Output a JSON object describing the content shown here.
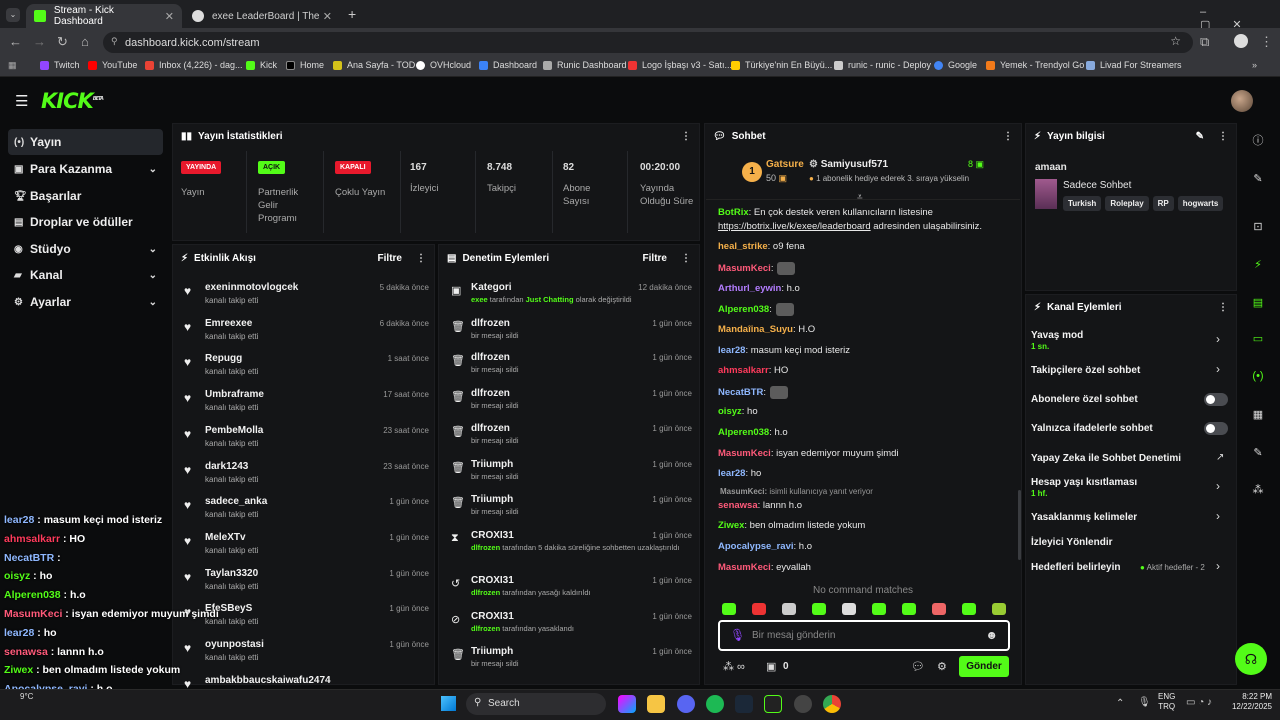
{
  "browser": {
    "tabs": [
      {
        "label": "Stream - Kick Dashboard"
      },
      {
        "label": "exee LeaderBoard | The best Ch"
      }
    ],
    "url": "dashboard.kick.com/stream",
    "bookmarks": [
      "Twitch",
      "YouTube",
      "Inbox (4,226) - dag...",
      "Kick",
      "Home",
      "Ana Sayfa - TOD",
      "OVHcloud",
      "Dashboard",
      "Runic Dashboard",
      "Logo İşbaşı v3 - Satı...",
      "Türkiye'nin En Büyü...",
      "runic - runic - Deploy",
      "Google",
      "Yemek - Trendyol Go",
      "Livad For Streamers"
    ]
  },
  "kick": {
    "logo": "KICK",
    "logo_beta": "BETA"
  },
  "sidebar": [
    {
      "label": "Yayın"
    },
    {
      "label": "Para Kazanma"
    },
    {
      "label": "Başarılar"
    },
    {
      "label": "Droplar ve ödüller"
    },
    {
      "label": "Stüdyo"
    },
    {
      "label": "Kanal"
    },
    {
      "label": "Ayarlar"
    }
  ],
  "stats": {
    "title": "Yayın İstatistikleri",
    "live_badge": "YAYINDA",
    "live_label": "Yayın",
    "partner_badge": "AÇIK",
    "partner_label": "Partnerlik Gelir Programı",
    "multi_badge": "KAPALI",
    "multi_label": "Çoklu Yayın",
    "viewers": "167",
    "viewers_label": "İzleyici",
    "followers": "8.748",
    "followers_label": "Takipçi",
    "subs": "82",
    "subs_label": "Abone Sayısı",
    "uptime": "00:20:00",
    "uptime_label": "Yayında Olduğu Süre"
  },
  "activity": {
    "title": "Etkinlik Akışı",
    "filter": "Filtre",
    "items": [
      {
        "name": "exeninmotovlogcek",
        "action": "kanalı takip etti",
        "time": "5 dakika önce"
      },
      {
        "name": "Emreexee",
        "action": "kanalı takip etti",
        "time": "6 dakika önce"
      },
      {
        "name": "Repugg",
        "action": "kanalı takip etti",
        "time": "1 saat önce"
      },
      {
        "name": "Umbraframe",
        "action": "kanalı takip etti",
        "time": "17 saat önce"
      },
      {
        "name": "PembeMolla",
        "action": "kanalı takip etti",
        "time": "23 saat önce"
      },
      {
        "name": "dark1243",
        "action": "kanalı takip etti",
        "time": "23 saat önce"
      },
      {
        "name": "sadece_anka",
        "action": "kanalı takip etti",
        "time": "1 gün önce"
      },
      {
        "name": "MeleXTv",
        "action": "kanalı takip etti",
        "time": "1 gün önce"
      },
      {
        "name": "Taylan3320",
        "action": "kanalı takip etti",
        "time": "1 gün önce"
      },
      {
        "name": "EfeSBeyS",
        "action": "kanalı takip etti",
        "time": "1 gün önce"
      },
      {
        "name": "oyunpostasi",
        "action": "kanalı takip etti",
        "time": "1 gün önce"
      },
      {
        "name": "ambakbbaucskaiwafu2474",
        "action": "",
        "time": ""
      }
    ]
  },
  "moderation": {
    "title": "Denetim Eylemleri",
    "filter": "Filtre",
    "items": [
      {
        "name": "Kategori",
        "pre": "exee",
        "mid": " tarafından ",
        "hl": "Just Chatting",
        "post": " olarak değiştirildi",
        "time": "12 dakika önce"
      },
      {
        "name": "dlfrozen",
        "pre": "",
        "mid": "bir mesajı sildi",
        "hl": "",
        "post": "",
        "time": "1 gün önce"
      },
      {
        "name": "dlfrozen",
        "pre": "",
        "mid": "bir mesajı sildi",
        "hl": "",
        "post": "",
        "time": "1 gün önce"
      },
      {
        "name": "dlfrozen",
        "pre": "",
        "mid": "bir mesajı sildi",
        "hl": "",
        "post": "",
        "time": "1 gün önce"
      },
      {
        "name": "dlfrozen",
        "pre": "",
        "mid": "bir mesajı sildi",
        "hl": "",
        "post": "",
        "time": "1 gün önce"
      },
      {
        "name": "Triiumph",
        "pre": "",
        "mid": "bir mesajı sildi",
        "hl": "",
        "post": "",
        "time": "1 gün önce"
      },
      {
        "name": "Triiumph",
        "pre": "",
        "mid": "bir mesajı sildi",
        "hl": "",
        "post": "",
        "time": "1 gün önce"
      },
      {
        "name": "CROXI31",
        "pre": "dlfrozen",
        "mid": " tarafından 5 dakika süreliğine sohbetten uzaklaştırıldı",
        "hl": "",
        "post": "",
        "time": "1 gün önce"
      },
      {
        "name": "CROXI31",
        "pre": "dlfrozen",
        "mid": " tarafından yasağı kaldırıldı",
        "hl": "",
        "post": "",
        "time": "1 gün önce"
      },
      {
        "name": "CROXI31",
        "pre": "dlfrozen",
        "mid": " tarafından yasaklandı",
        "hl": "",
        "post": "",
        "time": "1 gün önce"
      },
      {
        "name": "Triiumph",
        "pre": "",
        "mid": "bir mesajı sildi",
        "hl": "",
        "post": "",
        "time": "1 gün önce"
      }
    ]
  },
  "chat": {
    "title": "Sohbet",
    "pinned": {
      "rank": "1",
      "user1": "Gatsure",
      "count1": "50",
      "user2": "Samiyusuf571",
      "count2": "8",
      "note": "1 abonelik hediye ederek 3. sıraya yükselin"
    },
    "messages": [
      {
        "user": "BotRix",
        "color": "#53fc18",
        "text": ": En çok destek veren kullanıcıların listesine"
      },
      {
        "user": "",
        "color": "#fff",
        "text": "https://botrix.live/k/exee/leaderboard",
        "tail": " adresinden ulaşabilirsiniz."
      },
      {
        "user": "heal_strike",
        "color": "#f5b04a",
        "text": ": o9 fena"
      },
      {
        "user": "MasumKeci",
        "color": "#ff5a7a",
        "text": ":"
      },
      {
        "user": "Arthurl_eywin",
        "color": "#b37dff",
        "text": ": h.o"
      },
      {
        "user": "Alperen038",
        "color": "#53fc18",
        "text": ":"
      },
      {
        "user": "Mandaîina_Suyu",
        "color": "#f5b04a",
        "text": ": H.O"
      },
      {
        "user": "lear28",
        "color": "#8fb8ff",
        "text": ": masum keçi mod isteriz"
      },
      {
        "user": "ahmsalkarr",
        "color": "#ff3b5c",
        "text": ": HO"
      },
      {
        "user": "NecatBTR",
        "color": "#8fb8ff",
        "text": ":"
      },
      {
        "user": "oisyz",
        "color": "#53fc18",
        "text": ": ho"
      },
      {
        "user": "Alperen038",
        "color": "#53fc18",
        "text": ": h.o"
      },
      {
        "user": "MasumKeci",
        "color": "#ff5a7a",
        "text": ": isyan edemiyor muyum şimdi"
      },
      {
        "user": "lear28",
        "color": "#8fb8ff",
        "text": ": ho"
      },
      {
        "user": "MasumKeci:",
        "color": "#999",
        "text": " isimli kullanıcıya yanıt veriyor"
      },
      {
        "user": "senawsa",
        "color": "#ff5a7a",
        "text": ": lannn h.o"
      },
      {
        "user": "Ziwex",
        "color": "#53fc18",
        "text": ": ben olmadım listede yokum"
      },
      {
        "user": "Apocalypse_ravi",
        "color": "#8fb8ff",
        "text": ": h.o"
      },
      {
        "user": "MasumKeci",
        "color": "#ff5a7a",
        "text": ": eyvallah"
      }
    ],
    "no_command": "No command matches",
    "input_placeholder": "Bir mesaj gönderin",
    "points": "0",
    "send": "Gönder"
  },
  "stream_info": {
    "title": "Yayın bilgisi",
    "stream_title": "amaan",
    "category": "Sadece Sohbet",
    "tags": [
      "Turkish",
      "Roleplay",
      "RP",
      "hogwarts"
    ]
  },
  "channel_actions": {
    "title": "Kanal Eylemleri",
    "items": [
      {
        "label": "Yavaş mod",
        "sub": "1 sn."
      },
      {
        "label": "Takipçilere özel sohbet",
        "sub": ""
      },
      {
        "label": "Abonelere özel sohbet",
        "sub": ""
      },
      {
        "label": "Yalnızca ifadelerle sohbet",
        "sub": ""
      },
      {
        "label": "Yapay Zeka ile Sohbet Denetimi",
        "sub": ""
      },
      {
        "label": "Hesap yaşı kısıtlaması",
        "sub": "1 hf."
      },
      {
        "label": "Yasaklanmış kelimeler",
        "sub": ""
      },
      {
        "label": "İzleyici Yönlendir",
        "sub": ""
      },
      {
        "label": "Hedefleri belirleyin",
        "sub": ""
      }
    ],
    "goals_status": "Aktif hedefler - 2"
  },
  "overlay": [
    {
      "user": "lear28",
      "color": "#8fb8ff",
      "text": " : masum keçi mod isteriz"
    },
    {
      "user": "ahmsalkarr",
      "color": "#ff3b5c",
      "text": " : HO"
    },
    {
      "user": "NecatBTR",
      "color": "#8fb8ff",
      "text": " :"
    },
    {
      "user": "oisyz",
      "color": "#53fc18",
      "text": " : ho"
    },
    {
      "user": "Alperen038",
      "color": "#53fc18",
      "text": " : h.o"
    },
    {
      "user": "MasumKeci",
      "color": "#ff5a7a",
      "text": " : isyan edemiyor muyum şimdi"
    },
    {
      "user": "lear28",
      "color": "#8fb8ff",
      "text": " : ho"
    },
    {
      "user": "senawsa",
      "color": "#ff5a7a",
      "text": " : lannn h.o"
    },
    {
      "user": "Ziwex",
      "color": "#53fc18",
      "text": " : ben olmadım listede yokum"
    },
    {
      "user": "Apocalypse_ravi",
      "color": "#8fb8ff",
      "text": " : h.o"
    },
    {
      "user": "MasumKeci",
      "color": "#ff5a7a",
      "text": " : eyvallah"
    }
  ],
  "taskbar": {
    "search": "Search",
    "weather": "9°C",
    "lang1": "ENG",
    "lang2": "TRQ",
    "time": "8:22 PM",
    "date": "12/22/2025"
  },
  "colors": {
    "accent": "#53fc18",
    "live": "#e8192c",
    "panel": "#141517"
  }
}
